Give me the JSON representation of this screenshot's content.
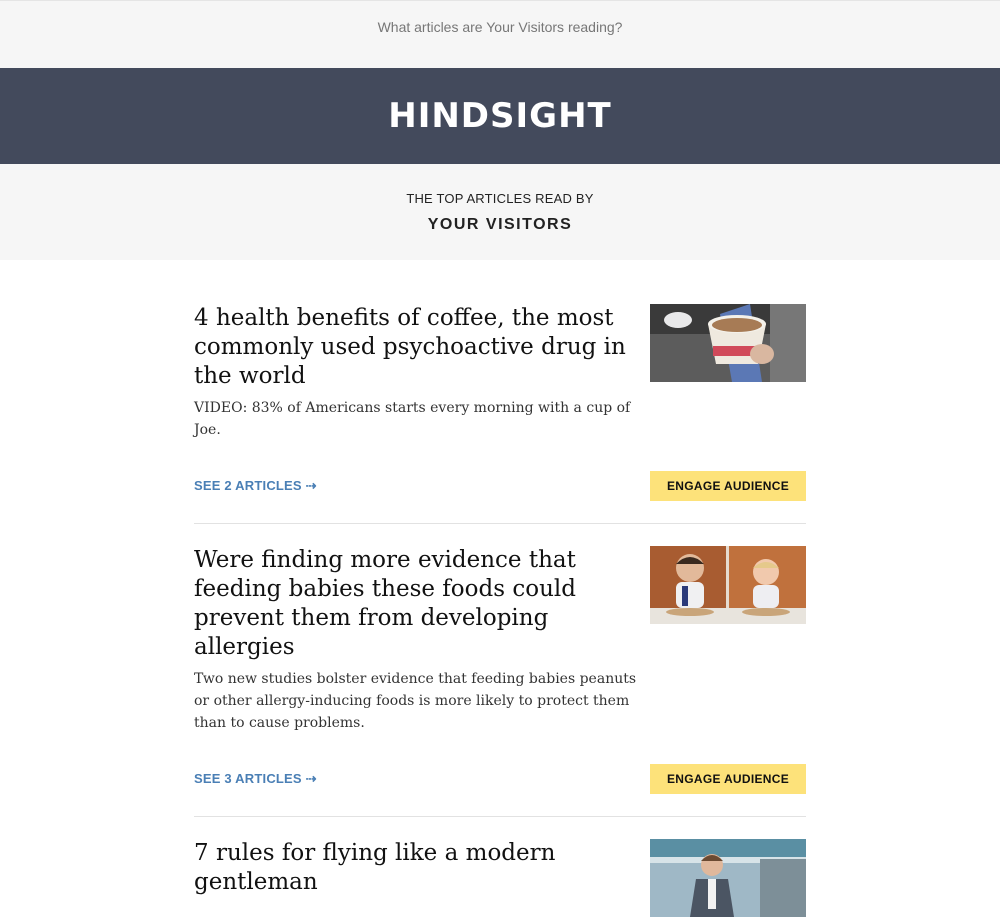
{
  "preheader": {
    "text": "What articles are Your Visitors reading?"
  },
  "brand": {
    "logo": "HINDSIGHT"
  },
  "subheader": {
    "line1": "THE TOP ARTICLES READ BY",
    "line2": "YOUR VISITORS"
  },
  "colors": {
    "brand_bar": "#434a5c",
    "link": "#4a7fb5",
    "button": "#fde27a"
  },
  "articles": [
    {
      "headline": "4 health benefits of coffee, the most commonly used psychoactive drug in the world",
      "summary": "VIDEO: 83% of Americans starts every morning with a cup of Joe.",
      "see_link": "SEE 2 ARTICLES ⇢",
      "button": "ENGAGE AUDIENCE",
      "image": "coffee-cup-photo"
    },
    {
      "headline": "Were finding more evidence that feeding babies these foods could prevent them from developing allergies",
      "summary": "Two new studies bolster evidence that feeding babies peanuts or other allergy-inducing foods is more likely to protect them than to cause problems.",
      "see_link": "SEE 3 ARTICLES ⇢",
      "button": "ENGAGE AUDIENCE",
      "image": "babies-eating-photo"
    },
    {
      "headline": "7 rules for flying like a modern gentleman",
      "image": "man-at-airport-photo"
    }
  ]
}
